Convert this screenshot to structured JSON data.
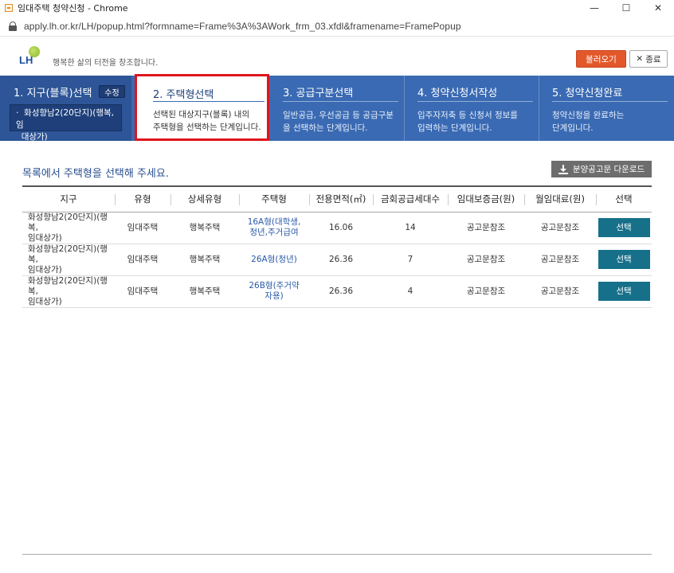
{
  "window": {
    "title": "임대주택 청약신청 - Chrome",
    "url": "apply.lh.or.kr/LH/popup.html?formname=Frame%3A%3AWork_frm_03.xfdl&framename=FramePopup",
    "minimize": "—",
    "maximize": "☐",
    "close": "✕"
  },
  "header": {
    "logo_text": "LH",
    "slogan": "행복한 삶의 터전을 창조합니다.",
    "load_button": "불러오기",
    "close_button": "종료",
    "close_icon": "✕"
  },
  "steps": [
    {
      "title": "1. 지구(블록)선택",
      "edit_label": "수정",
      "selected_bullet": "·",
      "selected_line1": "화성향남2(20단지)(행복,임",
      "selected_line2": "대상가)"
    },
    {
      "title": "2. 주택형선택",
      "desc_line1": "선택된 대상지구(블록) 내의",
      "desc_line2": "주택형을 선택하는 단계입니다."
    },
    {
      "title": "3. 공급구분선택",
      "desc_line1": "일반공급, 우선공급 등 공급구분",
      "desc_line2": "을 선택하는 단계입니다."
    },
    {
      "title": "4. 청약신청서작성",
      "desc_line1": "입주자저축 등 신청서 정보를",
      "desc_line2": "입력하는 단계입니다."
    },
    {
      "title": "5. 청약신청완료",
      "desc_line1": "청약신청을 완료하는",
      "desc_line2": "단계입니다."
    }
  ],
  "content": {
    "list_title": "목록에서 주택형을 선택해 주세요.",
    "download_button": "분양공고문 다운로드",
    "columns": [
      "지구",
      "유형",
      "상세유형",
      "주택형",
      "전용면적(㎡)",
      "금회공급세대수",
      "임대보증금(원)",
      "월임대료(원)",
      "선택"
    ],
    "rows": [
      {
        "district_line1": "화성향남2(20단지)(행복,",
        "district_line2": "임대상가)",
        "type": "임대주택",
        "detail_type": "행복주택",
        "housing_line1": "16A형(대학생,",
        "housing_line2": "청년,주거급여",
        "area": "16.06",
        "units": "14",
        "deposit": "공고문참조",
        "rent": "공고문참조",
        "select": "선택"
      },
      {
        "district_line1": "화성향남2(20단지)(행복,",
        "district_line2": "임대상가)",
        "type": "임대주택",
        "detail_type": "행복주택",
        "housing_line1": "26A형(청년)",
        "housing_line2": "",
        "area": "26.36",
        "units": "7",
        "deposit": "공고문참조",
        "rent": "공고문참조",
        "select": "선택"
      },
      {
        "district_line1": "화성향남2(20단지)(행복,",
        "district_line2": "임대상가)",
        "type": "임대주택",
        "detail_type": "행복주택",
        "housing_line1": "26B형(주거약",
        "housing_line2": "자용)",
        "area": "26.36",
        "units": "4",
        "deposit": "공고문참조",
        "rent": "공고문참조",
        "select": "선택"
      }
    ]
  },
  "colors": {
    "step_bar": "#3a6ab3",
    "highlight_border": "#e0141c",
    "load_button": "#e2582b",
    "select_button": "#16708a"
  }
}
